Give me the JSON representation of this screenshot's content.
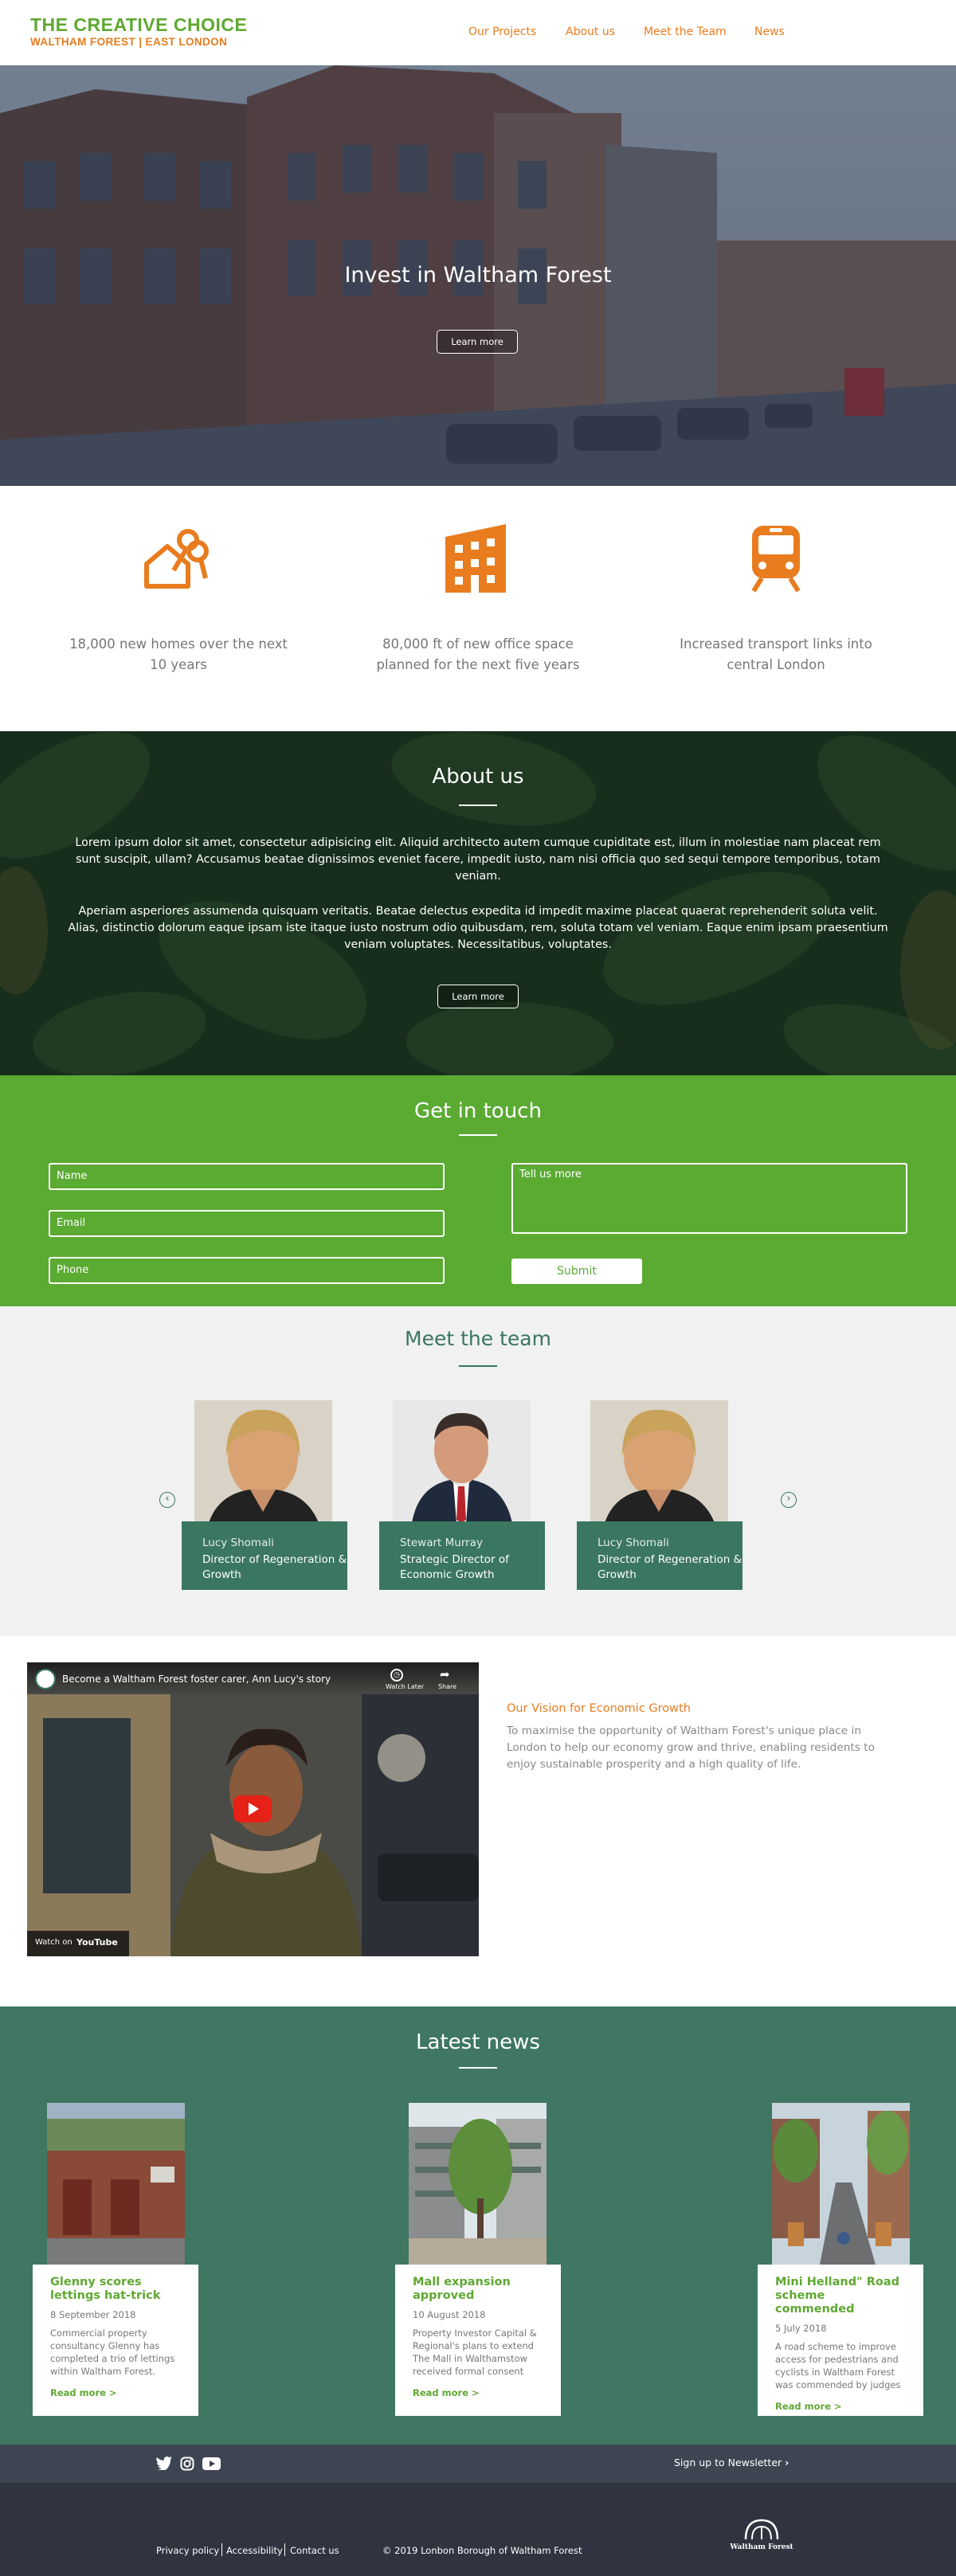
{
  "header": {
    "logo_line1": "THE CREATIVE CHOICE",
    "logo_line2": "WALTHAM FOREST | EAST LONDON",
    "nav": [
      "Our Projects",
      "About us",
      "Meet the Team",
      "News"
    ]
  },
  "hero": {
    "title": "Invest in Waltham Forest",
    "button": "Learn more"
  },
  "stats": [
    {
      "icon": "house-keys-icon",
      "text": "18,000 new homes over the next 10 years"
    },
    {
      "icon": "office-building-icon",
      "text": "80,000 ft of new office space planned for the next five years"
    },
    {
      "icon": "train-icon",
      "text": "Increased transport links into central London"
    }
  ],
  "about": {
    "title": "About us",
    "p1": "Lorem ipsum dolor sit amet, consectetur adipisicing elit. Aliquid architecto autem cumque cupiditate est, illum in molestiae nam placeat rem sunt suscipit, ullam? Accusamus beatae dignissimos eveniet facere, impedit iusto, nam nisi officia quo sed sequi tempore temporibus, totam veniam.",
    "p2": "Aperiam asperiores assumenda quisquam veritatis. Beatae delectus expedita id impedit maxime placeat quaerat reprehenderit soluta velit. Alias, distinctio dolorum eaque ipsam iste itaque iusto nostrum odio quibusdam, rem, soluta totam vel veniam. Eaque enim ipsam praesentium veniam voluptates. Necessitatibus, voluptates.",
    "button": "Learn more"
  },
  "contact": {
    "title": "Get in touch",
    "name_placeholder": "Name",
    "email_placeholder": "Email",
    "phone_placeholder": "Phone",
    "message_placeholder": "Tell us more",
    "submit": "Submit"
  },
  "team": {
    "title": "Meet the team",
    "members": [
      {
        "name": "Lucy Shomali",
        "role": "Director of Regeneration & Growth"
      },
      {
        "name": "Stewart Murray",
        "role": "Strategic Director of Economic Growth"
      },
      {
        "name": "Lucy Shomali",
        "role": "Director of Regeneration & Growth"
      }
    ],
    "prev": "‹",
    "next": "›"
  },
  "video": {
    "title": "Become a Waltham Forest foster carer, Ann Lucy's story",
    "watch_later": "Watch Later",
    "share": "Share",
    "watch_on": "Watch on",
    "youtube": "YouTube"
  },
  "vision": {
    "title": "Our Vision for Economic Growth",
    "text": "To maximise the opportunity of Waltham Forest's unique place in London to help our economy grow and thrive, enabling residents to enjoy sustainable prosperity and a high quality of life."
  },
  "news": {
    "title": "Latest news",
    "items": [
      {
        "title": "Glenny scores lettings hat-trick",
        "date": "8 September 2018",
        "text": "Commercial property consultancy Glenny has completed a trio of lettings within Waltham Forest.",
        "more": "Read more >"
      },
      {
        "title": "Mall expansion approved",
        "date": "10 August 2018",
        "text": "Property Investor Capital & Regional's plans to extend The Mall in Walthamstow received formal consent from the council at the end of last month. Th...",
        "more": "Read more >"
      },
      {
        "title": "Mini Helland\" Road scheme commended",
        "date": "5 July 2018",
        "text": "A road scheme to improve access for pedestrians and cyclists in Waltham Forest was commended by judges at...",
        "more": "Read more >"
      }
    ]
  },
  "footer": {
    "newsletter": "Sign up to Newsletter",
    "links": [
      "Privacy policy",
      "Accessibility",
      "Contact us"
    ],
    "copyright": "© 2019 Lonbon Borough of Waltham Forest",
    "logo_text": "Waltham Forest"
  },
  "colors": {
    "brand_green": "#5fa832",
    "brand_orange": "#e87c1e",
    "teal": "#3f7762",
    "footer_dark": "#2f3440"
  }
}
